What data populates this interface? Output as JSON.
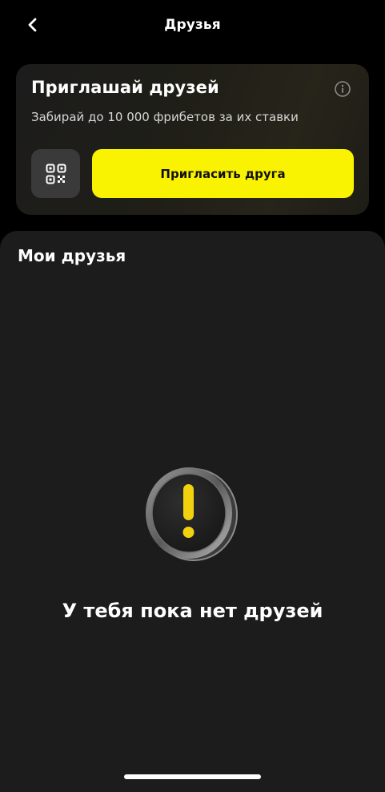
{
  "header": {
    "title": "Друзья",
    "back_icon": "chevron-left-icon"
  },
  "invite_card": {
    "title": "Приглашай друзей",
    "subtitle": "Забирай до 10 000 фрибетов за их ставки",
    "info_icon": "info-icon",
    "qr_icon": "qr-code-icon",
    "invite_button_label": "Пригласить друга",
    "accent_color": "#f9f200"
  },
  "friends": {
    "title": "Мои друзья",
    "empty_icon": "exclamation-coin-icon",
    "empty_text": "У тебя пока нет друзей"
  }
}
